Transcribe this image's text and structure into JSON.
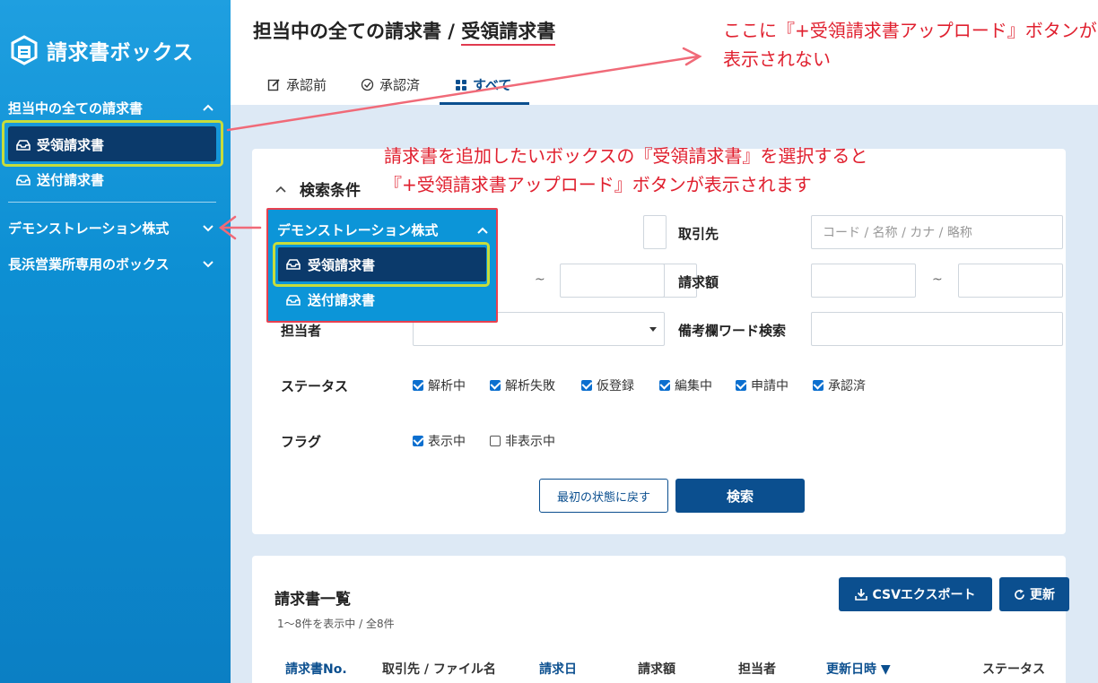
{
  "sidebar": {
    "logo_text": "請求書ボックス",
    "groups": [
      {
        "label": "担当中の全ての請求書",
        "items": [
          "受領請求書",
          "送付請求書"
        ]
      },
      {
        "label": "デモンストレーション株式"
      },
      {
        "label": "長浜営業所専用のボックス"
      }
    ]
  },
  "header": {
    "title_prefix": "担当中の全ての請求書 / ",
    "title_current": "受領請求書",
    "tabs": [
      {
        "label": "承認前",
        "icon": "edit-icon"
      },
      {
        "label": "承認済",
        "icon": "check-circle-icon"
      },
      {
        "label": "すべて",
        "icon": "grid-icon"
      }
    ]
  },
  "search": {
    "title": "検索条件",
    "labels": {
      "partner": "取引先",
      "amount": "請求額",
      "assignee": "担当者",
      "memo": "備考欄ワード検索",
      "status": "ステータス",
      "flag": "フラグ"
    },
    "partner_placeholder": "コード / 名称 / カナ / 略称",
    "tilde": "~",
    "statuses": [
      {
        "label": "解析中",
        "checked": true
      },
      {
        "label": "解析失敗",
        "checked": true
      },
      {
        "label": "仮登録",
        "checked": true
      },
      {
        "label": "編集中",
        "checked": true
      },
      {
        "label": "申請中",
        "checked": true
      },
      {
        "label": "承認済",
        "checked": true
      }
    ],
    "flags": [
      {
        "label": "表示中",
        "checked": true
      },
      {
        "label": "非表示中",
        "checked": false
      }
    ],
    "reset_label": "最初の状態に戻す",
    "search_label": "検索"
  },
  "list": {
    "title": "請求書一覧",
    "count": "1〜8件を表示中 / 全8件",
    "csv_label": "CSVエクスポート",
    "refresh_label": "更新",
    "columns": [
      "請求書No.",
      "取引先 / ファイル名",
      "請求日",
      "請求額",
      "担当者",
      "更新日時 ▼",
      "ステータス"
    ]
  },
  "popup": {
    "header": "デモンストレーション株式",
    "items": [
      "受領請求書",
      "送付請求書"
    ]
  },
  "annotations": {
    "top_line1": "ここに『+受領請求書アップロード』ボタンが",
    "top_line2": "表示されない",
    "mid_line1": "請求書を追加したいボックスの『受領請求書』を選択すると",
    "mid_line2": "『+受領請求書アップロード』ボタンが表示されます"
  },
  "colors": {
    "sidebar": "#0d8fd3",
    "primary": "#0b4f8f",
    "annotation": "#e0202f",
    "highlight": "#c7dc3b"
  }
}
